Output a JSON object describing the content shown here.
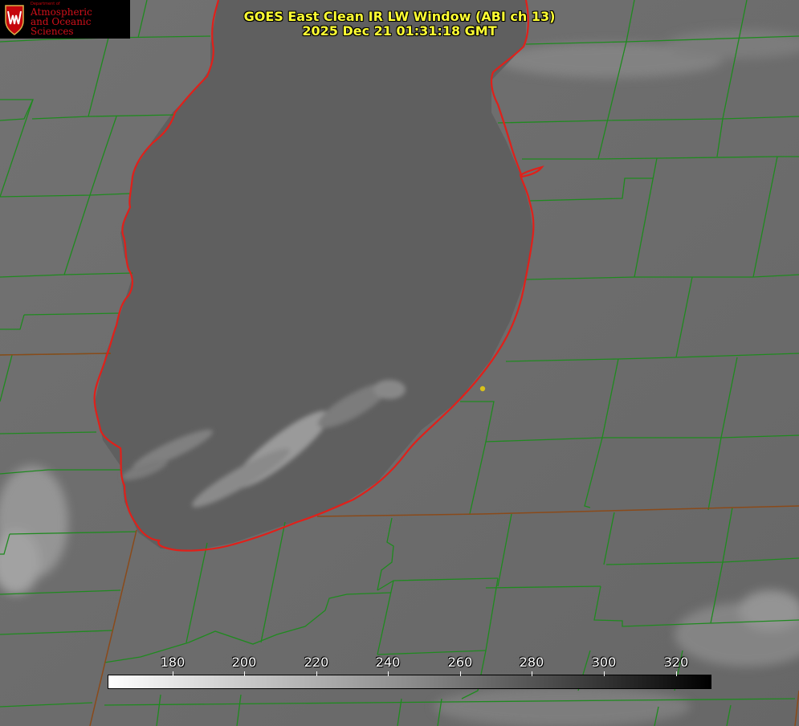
{
  "title": {
    "line1": "GOES East Clean IR LW Window (ABI ch 13)",
    "line2": "2025 Dec 21 01:31:18 GMT"
  },
  "logo": {
    "department": "Department of",
    "line1": "Atmospheric",
    "line2": "and Oceanic Sciences",
    "icon": "uw-crest-icon"
  },
  "colorbar": {
    "ticks": [
      "180",
      "200",
      "220",
      "240",
      "260",
      "280",
      "300",
      "320"
    ],
    "range": [
      162,
      330
    ],
    "gradient": "white-to-black"
  },
  "colors": {
    "land": "#6b6b6b",
    "lake": "#5e5e5e",
    "county_lines": "#1f8a1f",
    "shoreline": "#e0201a",
    "title": "#ffff33",
    "marker": "#d9c21a"
  },
  "map": {
    "feature": "lake-michigan-shoreline",
    "marker": "location-dot"
  }
}
